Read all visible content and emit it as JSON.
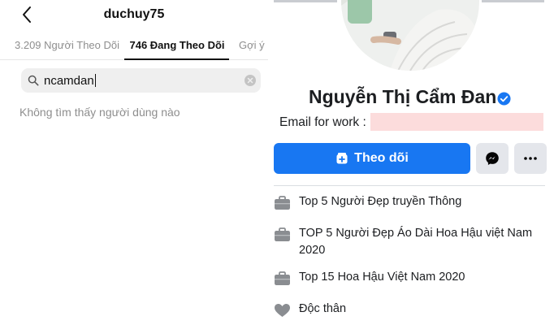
{
  "instagram": {
    "username": "duchuy75",
    "tabs": [
      {
        "label": "3.209 Người Theo Dõi",
        "active": false
      },
      {
        "label": "746 Đang Theo Dõi",
        "active": true
      },
      {
        "label": "Gợi ý",
        "active": false
      }
    ],
    "search": {
      "value": "ncamdan"
    },
    "empty_message": "Không tìm thấy người dùng nào"
  },
  "facebook": {
    "name": "Nguyễn Thị Cẩm Đan",
    "verified": true,
    "email_label": "Email for work :",
    "follow_label": "Theo dõi",
    "accent": "#1877f2",
    "info": [
      {
        "icon": "briefcase-icon",
        "text": "Top 5 Người Đẹp truyền Thông"
      },
      {
        "icon": "briefcase-icon",
        "text": "TOP 5 Người Đẹp Áo Dài Hoa Hậu việt Nam 2020"
      },
      {
        "icon": "briefcase-icon",
        "text": "Top 15 Hoa Hậu Việt Nam 2020"
      },
      {
        "icon": "heart-icon",
        "text": "Độc thân"
      }
    ]
  }
}
